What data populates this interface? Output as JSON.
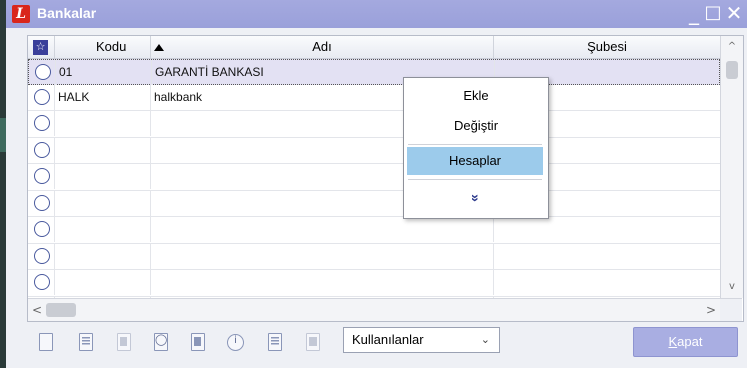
{
  "window": {
    "title": "Bankalar",
    "logo_letter": "L",
    "controls": {
      "minimize": "_",
      "maximize": "□",
      "close": "✕"
    }
  },
  "grid": {
    "columns": {
      "star": "☆",
      "kodu": "Kodu",
      "adi": "Adı",
      "subesi": "Şubesi"
    },
    "rows": [
      {
        "kodu": "01",
        "adi": "GARANTİ BANKASI",
        "subesi": "",
        "selected": true
      },
      {
        "kodu": "HALK",
        "adi": "halkbank",
        "subesi": ""
      },
      {
        "kodu": "",
        "adi": "",
        "subesi": ""
      },
      {
        "kodu": "",
        "adi": "",
        "subesi": ""
      },
      {
        "kodu": "",
        "adi": "",
        "subesi": ""
      },
      {
        "kodu": "",
        "adi": "",
        "subesi": ""
      },
      {
        "kodu": "",
        "adi": "",
        "subesi": ""
      },
      {
        "kodu": "",
        "adi": "",
        "subesi": ""
      },
      {
        "kodu": "",
        "adi": "",
        "subesi": ""
      },
      {
        "kodu": "",
        "adi": "",
        "subesi": ""
      }
    ],
    "scroll": {
      "up": "^",
      "down": "v",
      "left": "<",
      "right": ">"
    }
  },
  "context_menu": {
    "items": [
      {
        "label": "Ekle"
      },
      {
        "label": "Değiştir"
      },
      {
        "label": "Hesaplar",
        "highlighted": true
      }
    ],
    "more_glyph": "»"
  },
  "toolbar": {
    "icons": [
      "new-document-icon",
      "edit-icon",
      "delete-icon",
      "preview-icon",
      "copy-icon",
      "info-icon",
      "list-icon",
      "report-icon"
    ],
    "filter_value": "Kullanılanlar",
    "close_label_first": "K",
    "close_label_rest": "apat"
  },
  "colors": {
    "titlebar": "#9fa4dc",
    "selected_row": "#e3e1f3",
    "menu_highlight": "#9ccbeb",
    "button": "#a9aee2"
  }
}
